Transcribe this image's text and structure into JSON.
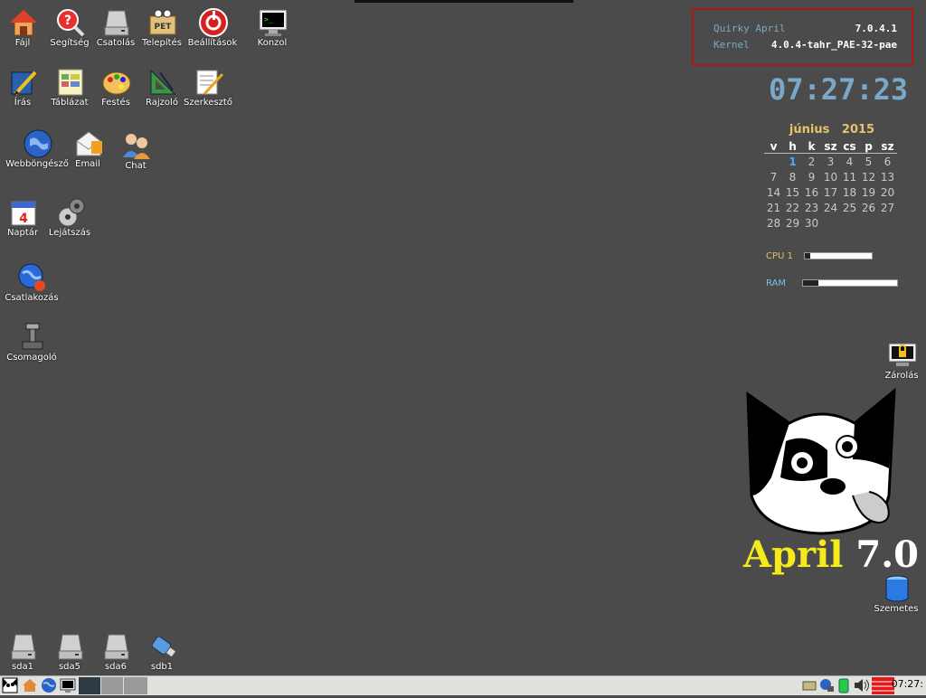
{
  "desktop_icons": [
    {
      "id": "fajl",
      "label": "Fájl",
      "icon": "home-icon"
    },
    {
      "id": "segitseg",
      "label": "Segítség",
      "icon": "help-magnifier-icon"
    },
    {
      "id": "csatolas",
      "label": "Csatolás",
      "icon": "drive-icon"
    },
    {
      "id": "telepites",
      "label": "Telepítés",
      "icon": "pet-package-icon"
    },
    {
      "id": "beallitasok",
      "label": "Beállítások",
      "icon": "settings-icon"
    },
    {
      "id": "konzol",
      "label": "Konzol",
      "icon": "terminal-icon"
    },
    {
      "id": "iras",
      "label": "Írás",
      "icon": "writer-icon"
    },
    {
      "id": "tablazat",
      "label": "Táblázat",
      "icon": "spreadsheet-icon"
    },
    {
      "id": "festes",
      "label": "Festés",
      "icon": "paint-palette-icon"
    },
    {
      "id": "rajzolo",
      "label": "Rajzoló",
      "icon": "draw-icon"
    },
    {
      "id": "szerkeszto",
      "label": "Szerkesztő",
      "icon": "text-editor-icon"
    },
    {
      "id": "webbongeszo",
      "label": "Webböngésző",
      "icon": "globe-icon"
    },
    {
      "id": "email",
      "label": "Email",
      "icon": "email-icon"
    },
    {
      "id": "chat",
      "label": "Chat",
      "icon": "chat-icon"
    },
    {
      "id": "naptar",
      "label": "Naptár",
      "icon": "calendar-icon"
    },
    {
      "id": "lejatszas",
      "label": "Lejátszás",
      "icon": "media-player-icon"
    },
    {
      "id": "csatlakozas",
      "label": "Csatlakozás",
      "icon": "network-connect-icon"
    },
    {
      "id": "csomagolo",
      "label": "Csomagoló",
      "icon": "package-manager-icon"
    },
    {
      "id": "sda1",
      "label": "sda1",
      "icon": "drive-icon"
    },
    {
      "id": "sda5",
      "label": "sda5",
      "icon": "drive-icon"
    },
    {
      "id": "sda6",
      "label": "sda6",
      "icon": "drive-icon"
    },
    {
      "id": "sdb1",
      "label": "sdb1",
      "icon": "usb-drive-icon"
    },
    {
      "id": "zarolas",
      "label": "Zárolás",
      "icon": "lock-screen-icon"
    },
    {
      "id": "szemetes",
      "label": "Szemetes",
      "icon": "trash-icon"
    }
  ],
  "sysinfo": {
    "distro_label": "Quirky April",
    "distro_version": "7.0.4.1",
    "kernel_label": "Kernel",
    "kernel_version": "4.0.4-tahr_PAE-32-pae"
  },
  "clock": "07:27:23",
  "calendar": {
    "month": "június",
    "year": "2015",
    "weekdays": [
      "v",
      "h",
      "k",
      "sz",
      "cs",
      "p",
      "sz"
    ],
    "weeks": [
      [
        "",
        "1",
        "2",
        "3",
        "4",
        "5",
        "6"
      ],
      [
        "7",
        "8",
        "9",
        "10",
        "11",
        "12",
        "13"
      ],
      [
        "14",
        "15",
        "16",
        "17",
        "18",
        "19",
        "20"
      ],
      [
        "21",
        "22",
        "23",
        "24",
        "25",
        "26",
        "27"
      ],
      [
        "28",
        "29",
        "30",
        "",
        "",
        "",
        ""
      ]
    ],
    "today": "1"
  },
  "meters": {
    "cpu": {
      "label": "CPU 1",
      "fraction": 0.08
    },
    "ram": {
      "label": "RAM",
      "fraction": 0.16
    }
  },
  "logo": {
    "brand": "April",
    "version": "7.0"
  },
  "taskbar": {
    "clock": "07:27:"
  },
  "colors": {
    "background": "#4b4b4b",
    "accent": "#7aa8c8",
    "highlight": "#f5ea1c",
    "border_red": "#b0161a"
  }
}
